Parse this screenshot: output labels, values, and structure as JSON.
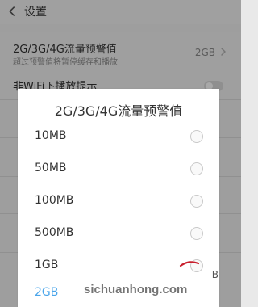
{
  "topbar": {
    "title": "设置"
  },
  "settings": {
    "rows": [
      {
        "title": "2G/3G/4G流量预警值",
        "subtitle": "超过预警值将暂停缓存和播放",
        "value": "2GB"
      },
      {
        "title": "非WiFi下播放提示"
      }
    ]
  },
  "dialog": {
    "title": "2G/3G/4G流量预警值",
    "options": [
      {
        "label": "10MB"
      },
      {
        "label": "50MB"
      },
      {
        "label": "100MB"
      },
      {
        "label": "500MB"
      },
      {
        "label": "1GB"
      },
      {
        "label": "2GB"
      }
    ],
    "selected": "2GB"
  },
  "overlay": {
    "watermark": "sichuanhong.com",
    "partial_text": "B"
  },
  "colors": {
    "accent": "#4aa5ea"
  }
}
